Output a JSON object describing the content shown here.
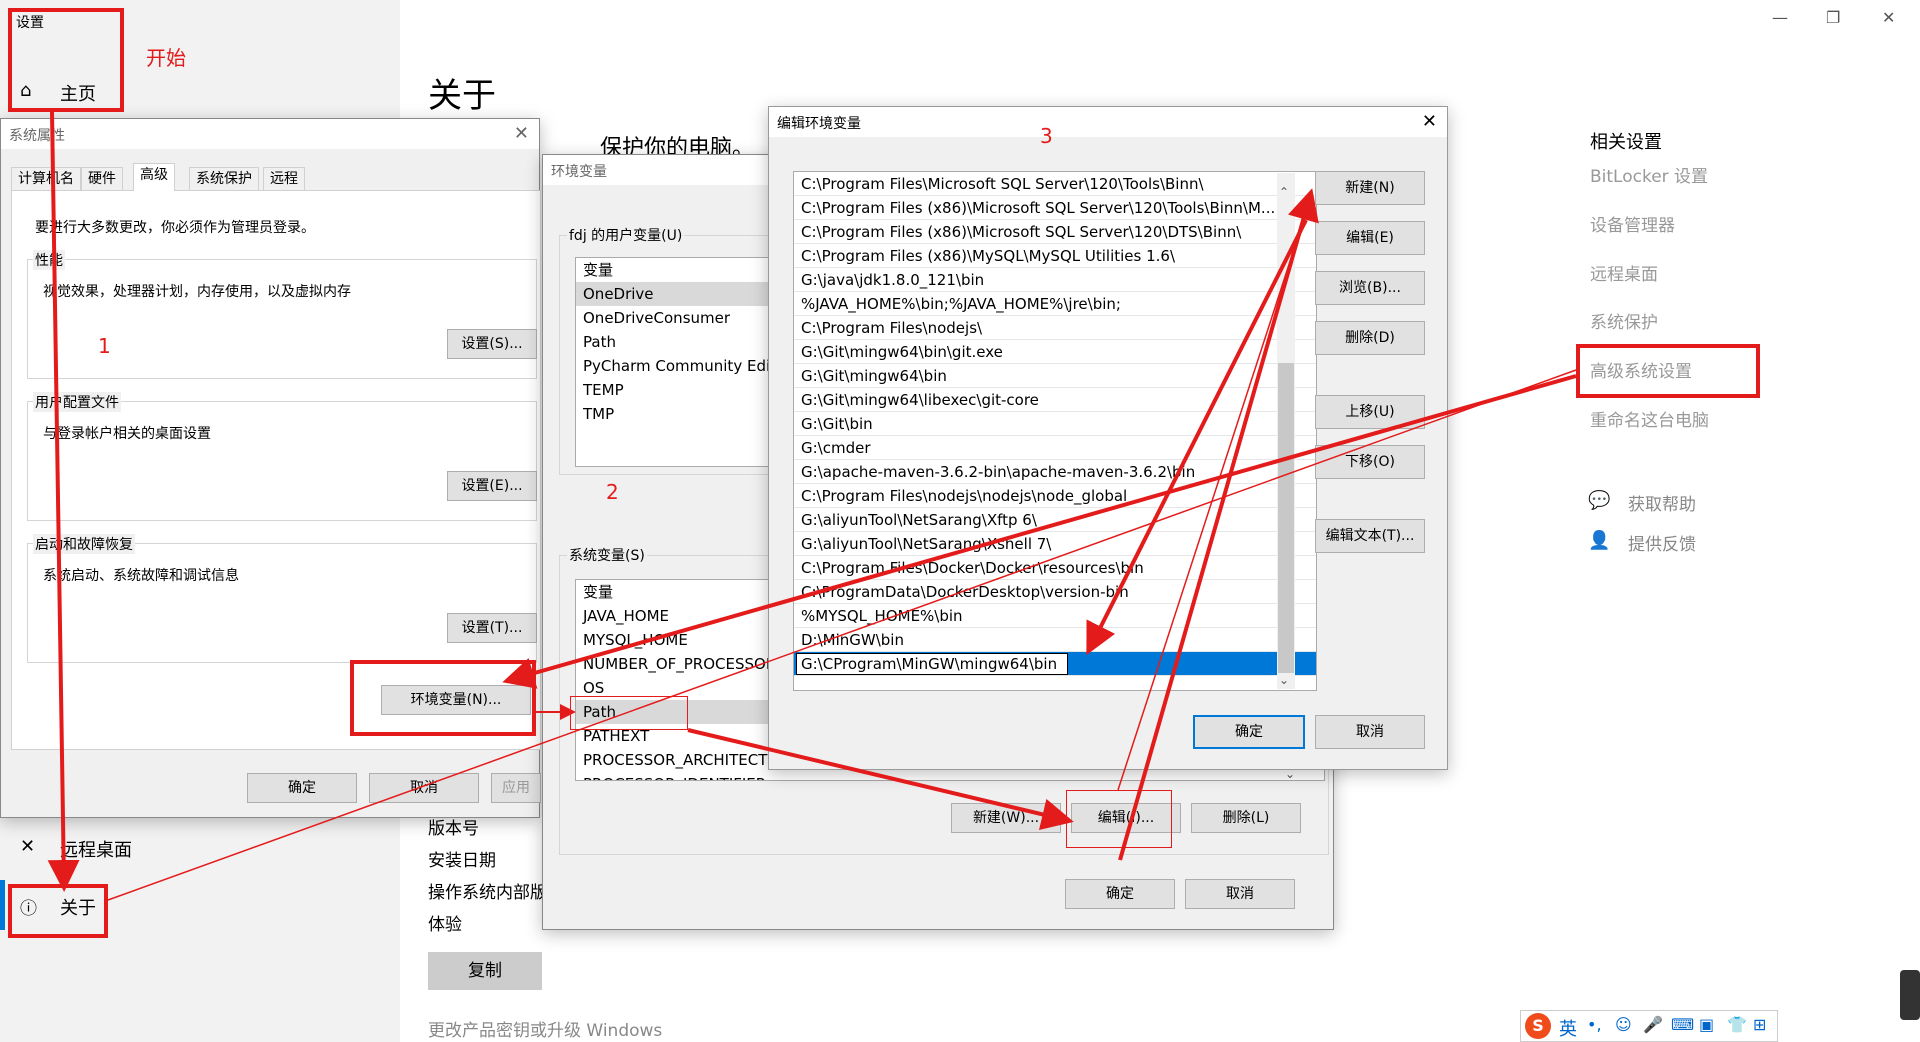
{
  "settings": {
    "window_title": "设置",
    "nav_home": "主页",
    "nav_remote_desktop": "远程桌面",
    "nav_about": "关于",
    "page_title": "关于",
    "protect_text": "保护你的电脑。",
    "spec_rows": [
      "版本号",
      "安装日期",
      "操作系统内部版本",
      "体验"
    ],
    "copy_button": "复制",
    "bottom_link": "更改产品密钥或升级 Windows",
    "related_heading": "相关设置",
    "related_links": [
      "BitLocker 设置",
      "设备管理器",
      "远程桌面",
      "系统保护",
      "高级系统设置",
      "重命名这台电脑"
    ],
    "help_link": "获取帮助",
    "feedback_link": "提供反馈"
  },
  "annotations": {
    "start_label": "开始",
    "step1": "1",
    "step2": "2",
    "step3": "3",
    "color": "#e41b1b"
  },
  "sys_props": {
    "title": "系统属性",
    "tabs": [
      "计算机名",
      "硬件",
      "高级",
      "系统保护",
      "远程"
    ],
    "admin_note": "要进行大多数更改，你必须作为管理员登录。",
    "perf_label": "性能",
    "perf_desc": "视觉效果，处理器计划，内存使用，以及虚拟内存",
    "perf_button": "设置(S)...",
    "profile_label": "用户配置文件",
    "profile_desc": "与登录帐户相关的桌面设置",
    "profile_button": "设置(E)...",
    "startup_label": "启动和故障恢复",
    "startup_desc": "系统启动、系统故障和调试信息",
    "startup_button": "设置(T)...",
    "env_button": "环境变量(N)...",
    "ok": "确定",
    "cancel": "取消",
    "apply": "应用"
  },
  "env_vars": {
    "title": "环境变量",
    "user_group_label": "fdj 的用户变量(U)",
    "user_header": "变量",
    "user_vars": [
      "OneDrive",
      "OneDriveConsumer",
      "Path",
      "PyCharm Community Editi",
      "TEMP",
      "TMP"
    ],
    "sys_group_label": "系统变量(S)",
    "sys_header": "变量",
    "sys_vars": [
      "JAVA_HOME",
      "MYSQL_HOME",
      "NUMBER_OF_PROCESSOR",
      "OS",
      "Path",
      "PATHEXT",
      "PROCESSOR_ARCHITECTU",
      "PROCESSOR_IDENTIFIER"
    ],
    "new_button": "新建(W)...",
    "edit_button": "编辑(I)...",
    "delete_button": "删除(L)",
    "ok": "确定",
    "cancel": "取消"
  },
  "edit_env": {
    "title": "编辑环境变量",
    "paths": [
      "C:\\Program Files\\Microsoft SQL Server\\120\\Tools\\Binn\\",
      "C:\\Program Files (x86)\\Microsoft SQL Server\\120\\Tools\\Binn\\M...",
      "C:\\Program Files (x86)\\Microsoft SQL Server\\120\\DTS\\Binn\\",
      "C:\\Program Files (x86)\\MySQL\\MySQL Utilities 1.6\\",
      "G:\\java\\jdk1.8.0_121\\bin",
      "%JAVA_HOME%\\bin;%JAVA_HOME%\\jre\\bin;",
      "C:\\Program Files\\nodejs\\",
      "G:\\Git\\mingw64\\bin\\git.exe",
      "G:\\Git\\mingw64\\bin",
      "G:\\Git\\mingw64\\libexec\\git-core",
      "G:\\Git\\bin",
      "G:\\cmder",
      "G:\\apache-maven-3.6.2-bin\\apache-maven-3.6.2\\bin",
      "C:\\Program Files\\nodejs\\nodejs\\node_global",
      "G:\\aliyunTool\\NetSarang\\Xftp 6\\",
      "G:\\aliyunTool\\NetSarang\\Xshell 7\\",
      "C:\\Program Files\\Docker\\Docker\\resources\\bin",
      "C:\\ProgramData\\DockerDesktop\\version-bin",
      "%MYSQL_HOME%\\bin",
      "D:\\MinGW\\bin"
    ],
    "editing_value": "G:\\CProgram\\MinGW\\mingw64\\bin",
    "buttons": [
      "新建(N)",
      "编辑(E)",
      "浏览(B)...",
      "删除(D)",
      "上移(U)",
      "下移(O)",
      "编辑文本(T)..."
    ],
    "ok": "确定",
    "cancel": "取消"
  },
  "ime_bar": {
    "lang": "英"
  }
}
